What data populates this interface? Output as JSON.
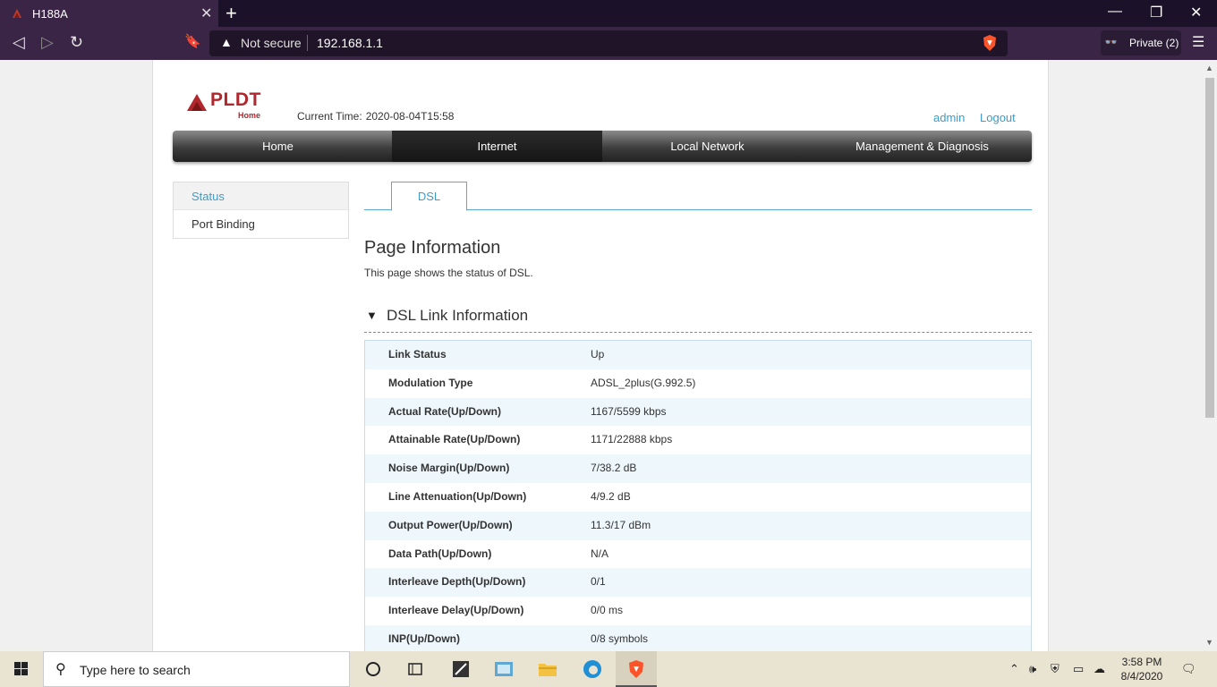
{
  "browser": {
    "tab_title": "H188A",
    "not_secure_label": "Not secure",
    "url": "192.168.1.1",
    "private_label": "Private (2)"
  },
  "header": {
    "logo_word": "PLDT",
    "logo_sub": "Home",
    "current_time_label": "Current Time:",
    "current_time_value": "2020-08-04T15:58",
    "user_link": "admin",
    "logout_link": "Logout"
  },
  "main_nav": [
    {
      "label": "Home"
    },
    {
      "label": "Internet"
    },
    {
      "label": "Local Network"
    },
    {
      "label": "Management & Diagnosis"
    }
  ],
  "side_nav": [
    {
      "label": "Status"
    },
    {
      "label": "Port Binding"
    }
  ],
  "sub_tab": "DSL",
  "page": {
    "title": "Page Information",
    "description": "This page shows the status of DSL.",
    "section_title": "DSL Link Information"
  },
  "dsl_info": [
    {
      "key": "Link Status",
      "value": "Up"
    },
    {
      "key": "Modulation Type",
      "value": "ADSL_2plus(G.992.5)"
    },
    {
      "key": "Actual Rate(Up/Down)",
      "value": "1167/5599 kbps"
    },
    {
      "key": "Attainable Rate(Up/Down)",
      "value": "1171/22888 kbps"
    },
    {
      "key": "Noise Margin(Up/Down)",
      "value": "7/38.2 dB"
    },
    {
      "key": "Line Attenuation(Up/Down)",
      "value": "4/9.2 dB"
    },
    {
      "key": "Output Power(Up/Down)",
      "value": "11.3/17 dBm"
    },
    {
      "key": "Data Path(Up/Down)",
      "value": "N/A"
    },
    {
      "key": "Interleave Depth(Up/Down)",
      "value": "0/1"
    },
    {
      "key": "Interleave Delay(Up/Down)",
      "value": "0/0 ms"
    },
    {
      "key": "INP(Up/Down)",
      "value": "0/8 symbols"
    }
  ],
  "taskbar": {
    "search_placeholder": "Type here to search",
    "time": "3:58 PM",
    "date": "8/4/2020"
  },
  "colors": {
    "brand_red": "#b0272e",
    "link_blue": "#3d9bc6"
  }
}
